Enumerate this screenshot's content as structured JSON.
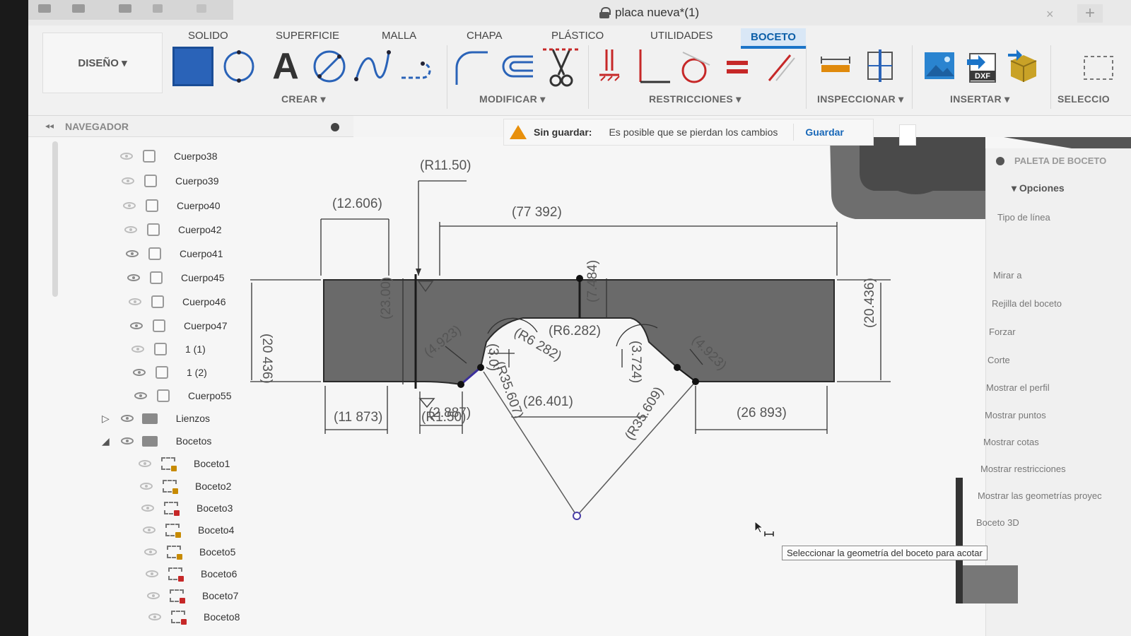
{
  "title_bar": {
    "document_title": "placa nueva*(1)",
    "close_glyph": "×",
    "new_tab_glyph": "+"
  },
  "ribbon": {
    "workspace_button": "DISEÑO ▾",
    "tabs": [
      "SOLIDO",
      "SUPERFICIE",
      "MALLA",
      "CHAPA",
      "PLÁSTICO",
      "UTILIDADES",
      "BOCETO"
    ],
    "active_tab": "BOCETO",
    "groups": {
      "create": "CREAR ▾",
      "modify": "MODIFICAR ▾",
      "constraints": "RESTRICCIONES ▾",
      "inspect": "INSPECCIONAR ▾",
      "insert": "INSERTAR ▾",
      "select": "SELECCIO"
    },
    "text_tool_glyph": "A",
    "dxf_label": "DXF"
  },
  "navigator": {
    "title": "NAVEGADOR",
    "items": [
      {
        "label": "Cuerpo38",
        "type": "body",
        "visible": false
      },
      {
        "label": "Cuerpo39",
        "type": "body",
        "visible": false
      },
      {
        "label": "Cuerpo40",
        "type": "body",
        "visible": false
      },
      {
        "label": "Cuerpo42",
        "type": "body",
        "visible": false
      },
      {
        "label": "Cuerpo41",
        "type": "body",
        "visible": true
      },
      {
        "label": "Cuerpo45",
        "type": "body",
        "visible": true
      },
      {
        "label": "Cuerpo46",
        "type": "body",
        "visible": false
      },
      {
        "label": "Cuerpo47",
        "type": "body",
        "visible": true
      },
      {
        "label": "1 (1)",
        "type": "body",
        "visible": false
      },
      {
        "label": "1 (2)",
        "type": "body",
        "visible": true
      },
      {
        "label": "Cuerpo55",
        "type": "body",
        "visible": true
      },
      {
        "label": "Lienzos",
        "type": "folder",
        "visible": true
      },
      {
        "label": "Bocetos",
        "type": "folder",
        "visible": true
      },
      {
        "label": "Boceto1",
        "type": "sketch",
        "visible": false
      },
      {
        "label": "Boceto2",
        "type": "sketch",
        "visible": false
      },
      {
        "label": "Boceto3",
        "type": "sketch-locked",
        "visible": false
      },
      {
        "label": "Boceto4",
        "type": "sketch",
        "visible": false
      },
      {
        "label": "Boceto5",
        "type": "sketch",
        "visible": false
      },
      {
        "label": "Boceto6",
        "type": "sketch-locked",
        "visible": false
      },
      {
        "label": "Boceto7",
        "type": "sketch-locked",
        "visible": false
      },
      {
        "label": "Boceto8",
        "type": "sketch-locked",
        "visible": false
      }
    ]
  },
  "warning": {
    "title": "Sin guardar:",
    "message": "Es posible que se pierdan los cambios",
    "save_button": "Guardar"
  },
  "sketch_palette": {
    "title": "PALETA DE BOCETO",
    "section": "▾ Opciones",
    "items": [
      "Tipo de línea",
      "Mirar a",
      "Rejilla del boceto",
      "Forzar",
      "Corte",
      "Mostrar el perfil",
      "Mostrar puntos",
      "Mostrar cotas",
      "Mostrar restricciones",
      "Mostrar las geometrías proyec",
      "Boceto 3D"
    ]
  },
  "tooltip": "Seleccionar la geometría del boceto para acotar",
  "dimensions": {
    "r11_50": "(R11.50)",
    "d12_606": "(12.606)",
    "d77_392": "(77 392)",
    "d20_436_left": "(20 436)",
    "d20_436_right": "(20.436)",
    "d23_00": "(23.00)",
    "d4_923_left": "(4.923)",
    "d4_923_right": "(4.923)",
    "r6_282_left": "(R6 282)",
    "r6_282_mid": "(R6.282)",
    "d7_484": "(7.484)",
    "d3_724": "(3.724)",
    "d26_401": "(26.401)",
    "r35_609": "(R35.609)",
    "r35_607": "(R35.607)",
    "d3_0": "(3.0)",
    "d11_873": "(11 873)",
    "d2_887": "(2.887)",
    "r1_50": "(R1.50)",
    "d26_893": "(26 893)"
  }
}
